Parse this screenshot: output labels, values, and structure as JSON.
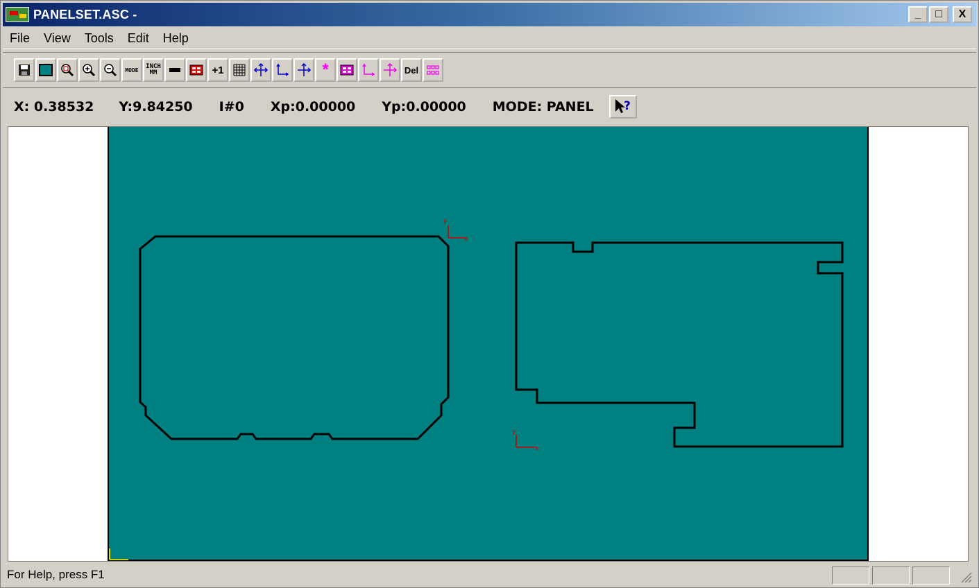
{
  "window": {
    "title": "PANELSET.ASC -",
    "controls": {
      "minimize": "_",
      "maximize": "□",
      "close": "X"
    }
  },
  "menu": {
    "items": [
      "File",
      "View",
      "Tools",
      "Edit",
      "Help"
    ]
  },
  "toolbar": {
    "buttons": [
      {
        "name": "save-icon"
      },
      {
        "name": "panel-color-icon"
      },
      {
        "name": "zoom-window-icon"
      },
      {
        "name": "zoom-in-icon"
      },
      {
        "name": "zoom-out-icon"
      },
      {
        "name": "mode-icon",
        "label": "MODE"
      },
      {
        "name": "inch-mm-icon",
        "label_top": "INCH",
        "label_bottom": "MM"
      },
      {
        "name": "bar-icon"
      },
      {
        "name": "panel-layout-icon"
      },
      {
        "name": "plus-one-icon",
        "label": "+1"
      },
      {
        "name": "grid-icon"
      },
      {
        "name": "move-icon"
      },
      {
        "name": "origin-axes-icon"
      },
      {
        "name": "crosshair-icon"
      },
      {
        "name": "star-icon",
        "label": "*"
      },
      {
        "name": "array-icon"
      },
      {
        "name": "origin-axes-magenta-icon"
      },
      {
        "name": "crosshair-magenta-icon"
      },
      {
        "name": "delete-icon",
        "label": "Del"
      },
      {
        "name": "step-repeat-icon"
      }
    ]
  },
  "coords": {
    "x": "X: 0.38532",
    "y": "Y:9.84250",
    "index": "I#0",
    "xp": "Xp:0.00000",
    "yp": "Yp:0.00000",
    "mode": "MODE: PANEL"
  },
  "status": {
    "help": "For Help, press F1"
  },
  "colors": {
    "panel": "#008080",
    "outline": "#000000",
    "origin_marker": "#cc0000",
    "panel_origin_marker": "#ffff00"
  }
}
